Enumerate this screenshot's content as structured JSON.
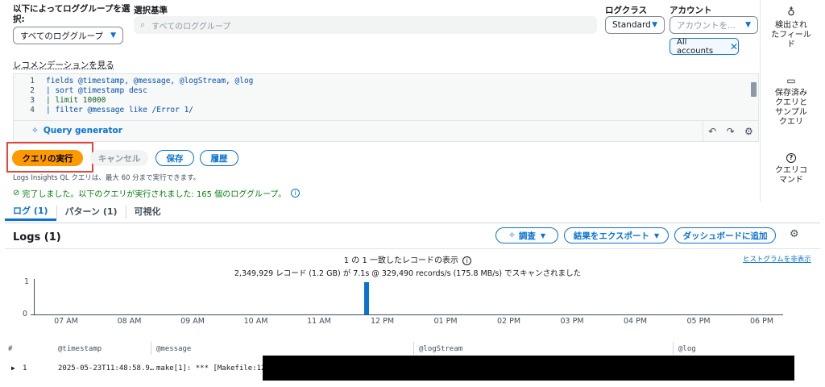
{
  "filter": {
    "log_group_label": "以下によってロググループを選\n択:",
    "log_group_value": "すべてのロググループ",
    "criteria_label": "選択基準",
    "criteria_placeholder": "すべてのロググループ",
    "log_class_label": "ログクラス",
    "log_class_value": "Standard",
    "account_label": "アカウント",
    "account_placeholder": "アカウントを...",
    "account_token": "All accounts"
  },
  "recommend_link": "レコメンデーションを見る",
  "editor": {
    "lines": [
      {
        "n": "1",
        "text": "fields @timestamp, @message, @logStream, @log"
      },
      {
        "n": "2",
        "text": "| sort @timestamp desc"
      },
      {
        "n": "3",
        "text": "| limit 10000"
      },
      {
        "n": "4",
        "text": "| filter @message like /Error 1/"
      }
    ],
    "query_generator": "Query generator"
  },
  "actions": {
    "run": "クエリの実行",
    "cancel": "キャンセル",
    "save": "保存",
    "history": "履歴",
    "note": "Logs Insights QL クエリは、最大 60 分まで実行できます。",
    "status": "完了しました。以下のクエリが実行されました: 165 個のロググループ。"
  },
  "tabs": [
    {
      "label": "ログ (1)"
    },
    {
      "label": "パターン (1)"
    },
    {
      "label": "可視化"
    }
  ],
  "logs_panel": {
    "title": "Logs (1)",
    "investigate": "調査",
    "export": "結果をエクスポート",
    "dashboard": "ダッシュボードに追加",
    "hide_histogram": "ヒストグラムを非表示",
    "records_shown": "1 の 1 一致したレコードの表示",
    "scan_stats": "2,349,929 レコード (1.2 GB) が 7.1s @ 329,490 records/s (175.8 MB/s) でスキャンされました"
  },
  "chart_data": {
    "type": "bar",
    "categories": [
      "07 AM",
      "08 AM",
      "09 AM",
      "10 AM",
      "11 AM",
      "12 PM",
      "01 PM",
      "02 PM",
      "03 PM",
      "04 PM",
      "05 PM",
      "06 PM"
    ],
    "y_ticks": [
      "1",
      "0"
    ],
    "ylim": [
      0,
      1
    ],
    "bar_position_hours_after_7am": 4.75,
    "values": [
      1
    ],
    "bar_color": "#0972d3"
  },
  "table": {
    "columns": [
      "#",
      "@timestamp",
      "@message",
      "@logStream",
      "@log"
    ],
    "rows": [
      {
        "index": "1",
        "timestamp": "2025-05-23T11:48:58.9…",
        "message": "make[1]: *** [Makefile:128:"
      }
    ]
  },
  "rail": {
    "fields": "検出され\nたフィール\nド",
    "saved": "保存済み\nクエリと\nサンプル\nクエリ",
    "commands": "クエリコ\nマンド"
  },
  "colors": {
    "accent": "#0972d3",
    "run_button": "#ff9900",
    "highlight": "#e5453b",
    "success": "#037f0c"
  }
}
